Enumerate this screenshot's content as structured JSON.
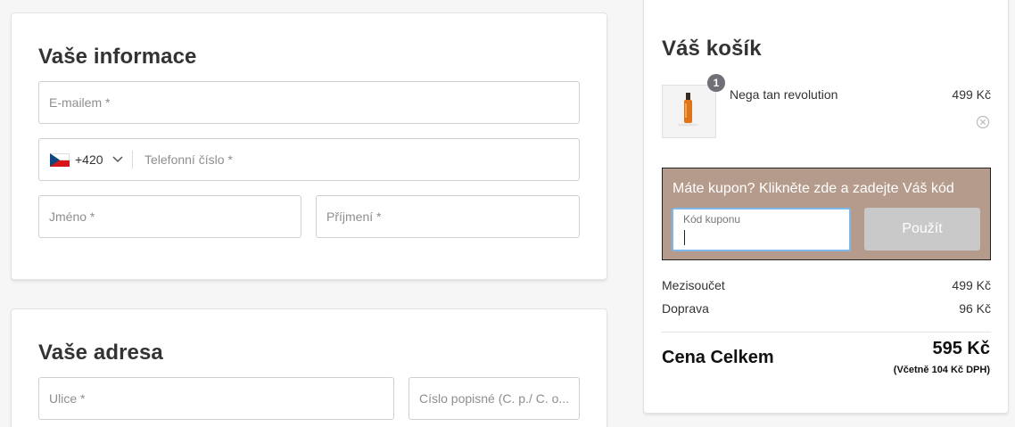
{
  "info": {
    "title": "Vaše informace",
    "email_placeholder": "E-mailem *",
    "phone": {
      "dial_code": "+420",
      "placeholder": "Telefonní číslo *",
      "flag_icon": "czech-flag-icon"
    },
    "first_name_placeholder": "Jméno *",
    "last_name_placeholder": "Příjmení *"
  },
  "address": {
    "title": "Vaše adresa",
    "street_placeholder": "Ulice *",
    "number_placeholder": "Císlo popisné (C. p./ C. o..."
  },
  "cart": {
    "title": "Váš košík",
    "items": [
      {
        "quantity": "1",
        "name": "Nega tan revolution",
        "price": "499 Kč"
      }
    ],
    "coupon": {
      "prompt": "Máte kupon? Klikněte zde a zadejte Váš kód",
      "input_label": "Kód kuponu",
      "input_value": "",
      "apply_label": "Použít"
    },
    "subtotal_label": "Mezisoučet",
    "subtotal_value": "499 Kč",
    "shipping_label": "Doprava",
    "shipping_value": "96 Kč",
    "total_label": "Cena Celkem",
    "total_value": "595 Kč",
    "vat_note": "(Včetně 104 Kč DPH)"
  },
  "colors": {
    "coupon_bg": "#b59b8b",
    "button_disabled": "#c9c9c9",
    "input_focus": "#7db9ea",
    "qty_badge": "#6f6f75"
  }
}
